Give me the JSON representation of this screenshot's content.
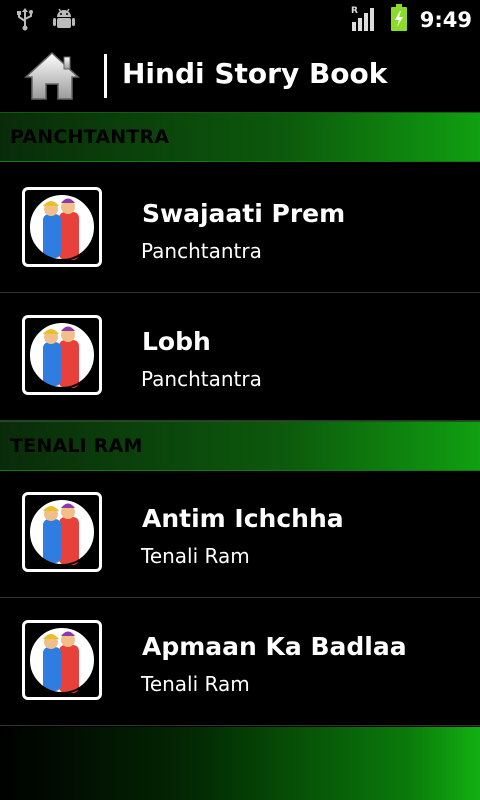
{
  "statusbar": {
    "time": "9:49",
    "icons": [
      "usb-icon",
      "android-debug-icon",
      "signal-roaming-icon",
      "battery-charging-icon"
    ],
    "roaming_letter": "R"
  },
  "appbar": {
    "title": "Hindi Story Book",
    "home_icon": "home-icon"
  },
  "sections": [
    {
      "label": "PANCHTANTRA",
      "items": [
        {
          "title": "Swajaati Prem",
          "subtitle": "Panchtantra"
        },
        {
          "title": "Lobh",
          "subtitle": "Panchtantra"
        }
      ]
    },
    {
      "label": "TENALI RAM",
      "items": [
        {
          "title": "Antim Ichchha",
          "subtitle": "Tenali Ram"
        },
        {
          "title": "Apmaan Ka Badlaa",
          "subtitle": "Tenali Ram"
        }
      ]
    }
  ],
  "colors": {
    "section_gradient_end": "#10a010",
    "background": "#000000",
    "battery": "#8bdc2a"
  }
}
